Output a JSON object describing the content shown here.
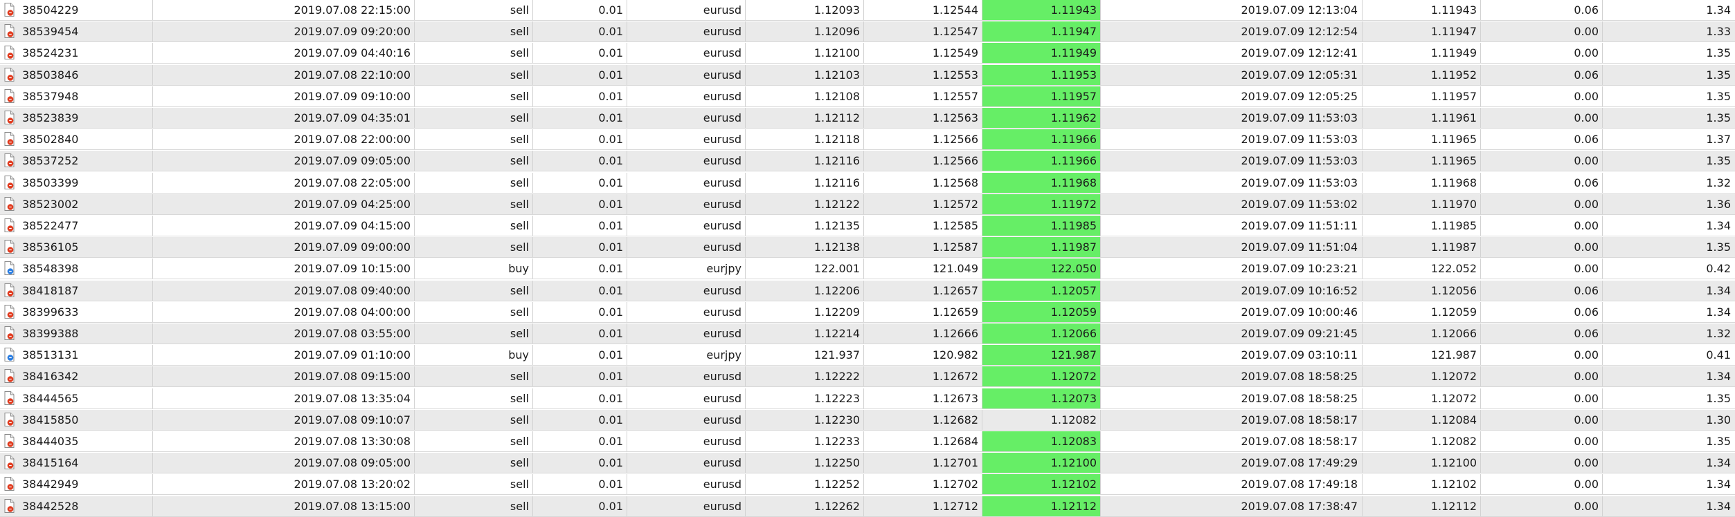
{
  "colors": {
    "highlight": "#66ee66",
    "sell_dot": "#e03a1e",
    "buy_dot": "#2a7de1",
    "row_alt": "#eaeaea"
  },
  "rows": [
    {
      "ticket": "38504229",
      "open_time": "2019.07.08 22:15:00",
      "type": "sell",
      "volume": "0.01",
      "symbol": "eurusd",
      "open_price": "1.12093",
      "sl": "1.12544",
      "tp": "1.11943",
      "tp_hit": true,
      "close_time": "2019.07.09 12:13:04",
      "close_price": "1.11943",
      "commission": "0.06",
      "swap": "1.34",
      "icon": "sell-order-icon"
    },
    {
      "ticket": "38539454",
      "open_time": "2019.07.09 09:20:00",
      "type": "sell",
      "volume": "0.01",
      "symbol": "eurusd",
      "open_price": "1.12096",
      "sl": "1.12547",
      "tp": "1.11947",
      "tp_hit": true,
      "close_time": "2019.07.09 12:12:54",
      "close_price": "1.11947",
      "commission": "0.00",
      "swap": "1.33",
      "icon": "sell-order-icon"
    },
    {
      "ticket": "38524231",
      "open_time": "2019.07.09 04:40:16",
      "type": "sell",
      "volume": "0.01",
      "symbol": "eurusd",
      "open_price": "1.12100",
      "sl": "1.12549",
      "tp": "1.11949",
      "tp_hit": true,
      "close_time": "2019.07.09 12:12:41",
      "close_price": "1.11949",
      "commission": "0.00",
      "swap": "1.35",
      "icon": "sell-order-icon"
    },
    {
      "ticket": "38503846",
      "open_time": "2019.07.08 22:10:00",
      "type": "sell",
      "volume": "0.01",
      "symbol": "eurusd",
      "open_price": "1.12103",
      "sl": "1.12553",
      "tp": "1.11953",
      "tp_hit": true,
      "close_time": "2019.07.09 12:05:31",
      "close_price": "1.11952",
      "commission": "0.06",
      "swap": "1.35",
      "icon": "sell-order-icon"
    },
    {
      "ticket": "38537948",
      "open_time": "2019.07.09 09:10:00",
      "type": "sell",
      "volume": "0.01",
      "symbol": "eurusd",
      "open_price": "1.12108",
      "sl": "1.12557",
      "tp": "1.11957",
      "tp_hit": true,
      "close_time": "2019.07.09 12:05:25",
      "close_price": "1.11957",
      "commission": "0.00",
      "swap": "1.35",
      "icon": "sell-order-icon"
    },
    {
      "ticket": "38523839",
      "open_time": "2019.07.09 04:35:01",
      "type": "sell",
      "volume": "0.01",
      "symbol": "eurusd",
      "open_price": "1.12112",
      "sl": "1.12563",
      "tp": "1.11962",
      "tp_hit": true,
      "close_time": "2019.07.09 11:53:03",
      "close_price": "1.11961",
      "commission": "0.00",
      "swap": "1.35",
      "icon": "sell-order-icon"
    },
    {
      "ticket": "38502840",
      "open_time": "2019.07.08 22:00:00",
      "type": "sell",
      "volume": "0.01",
      "symbol": "eurusd",
      "open_price": "1.12118",
      "sl": "1.12566",
      "tp": "1.11966",
      "tp_hit": true,
      "close_time": "2019.07.09 11:53:03",
      "close_price": "1.11965",
      "commission": "0.06",
      "swap": "1.37",
      "icon": "sell-order-icon"
    },
    {
      "ticket": "38537252",
      "open_time": "2019.07.09 09:05:00",
      "type": "sell",
      "volume": "0.01",
      "symbol": "eurusd",
      "open_price": "1.12116",
      "sl": "1.12566",
      "tp": "1.11966",
      "tp_hit": true,
      "close_time": "2019.07.09 11:53:03",
      "close_price": "1.11965",
      "commission": "0.00",
      "swap": "1.35",
      "icon": "sell-order-icon"
    },
    {
      "ticket": "38503399",
      "open_time": "2019.07.08 22:05:00",
      "type": "sell",
      "volume": "0.01",
      "symbol": "eurusd",
      "open_price": "1.12116",
      "sl": "1.12568",
      "tp": "1.11968",
      "tp_hit": true,
      "close_time": "2019.07.09 11:53:03",
      "close_price": "1.11968",
      "commission": "0.06",
      "swap": "1.32",
      "icon": "sell-order-icon"
    },
    {
      "ticket": "38523002",
      "open_time": "2019.07.09 04:25:00",
      "type": "sell",
      "volume": "0.01",
      "symbol": "eurusd",
      "open_price": "1.12122",
      "sl": "1.12572",
      "tp": "1.11972",
      "tp_hit": true,
      "close_time": "2019.07.09 11:53:02",
      "close_price": "1.11970",
      "commission": "0.00",
      "swap": "1.36",
      "icon": "sell-order-icon"
    },
    {
      "ticket": "38522477",
      "open_time": "2019.07.09 04:15:00",
      "type": "sell",
      "volume": "0.01",
      "symbol": "eurusd",
      "open_price": "1.12135",
      "sl": "1.12585",
      "tp": "1.11985",
      "tp_hit": true,
      "close_time": "2019.07.09 11:51:11",
      "close_price": "1.11985",
      "commission": "0.00",
      "swap": "1.34",
      "icon": "sell-order-icon"
    },
    {
      "ticket": "38536105",
      "open_time": "2019.07.09 09:00:00",
      "type": "sell",
      "volume": "0.01",
      "symbol": "eurusd",
      "open_price": "1.12138",
      "sl": "1.12587",
      "tp": "1.11987",
      "tp_hit": true,
      "close_time": "2019.07.09 11:51:04",
      "close_price": "1.11987",
      "commission": "0.00",
      "swap": "1.35",
      "icon": "sell-order-icon"
    },
    {
      "ticket": "38548398",
      "open_time": "2019.07.09 10:15:00",
      "type": "buy",
      "volume": "0.01",
      "symbol": "eurjpy",
      "open_price": "122.001",
      "sl": "121.049",
      "tp": "122.050",
      "tp_hit": true,
      "close_time": "2019.07.09 10:23:21",
      "close_price": "122.052",
      "commission": "0.00",
      "swap": "0.42",
      "icon": "buy-order-icon"
    },
    {
      "ticket": "38418187",
      "open_time": "2019.07.08 09:40:00",
      "type": "sell",
      "volume": "0.01",
      "symbol": "eurusd",
      "open_price": "1.12206",
      "sl": "1.12657",
      "tp": "1.12057",
      "tp_hit": true,
      "close_time": "2019.07.09 10:16:52",
      "close_price": "1.12056",
      "commission": "0.06",
      "swap": "1.34",
      "icon": "sell-order-icon"
    },
    {
      "ticket": "38399633",
      "open_time": "2019.07.08 04:00:00",
      "type": "sell",
      "volume": "0.01",
      "symbol": "eurusd",
      "open_price": "1.12209",
      "sl": "1.12659",
      "tp": "1.12059",
      "tp_hit": true,
      "close_time": "2019.07.09 10:00:46",
      "close_price": "1.12059",
      "commission": "0.06",
      "swap": "1.34",
      "icon": "sell-order-icon"
    },
    {
      "ticket": "38399388",
      "open_time": "2019.07.08 03:55:00",
      "type": "sell",
      "volume": "0.01",
      "symbol": "eurusd",
      "open_price": "1.12214",
      "sl": "1.12666",
      "tp": "1.12066",
      "tp_hit": true,
      "close_time": "2019.07.09 09:21:45",
      "close_price": "1.12066",
      "commission": "0.06",
      "swap": "1.32",
      "icon": "sell-order-icon"
    },
    {
      "ticket": "38513131",
      "open_time": "2019.07.09 01:10:00",
      "type": "buy",
      "volume": "0.01",
      "symbol": "eurjpy",
      "open_price": "121.937",
      "sl": "120.982",
      "tp": "121.987",
      "tp_hit": true,
      "close_time": "2019.07.09 03:10:11",
      "close_price": "121.987",
      "commission": "0.00",
      "swap": "0.41",
      "icon": "buy-order-icon"
    },
    {
      "ticket": "38416342",
      "open_time": "2019.07.08 09:15:00",
      "type": "sell",
      "volume": "0.01",
      "symbol": "eurusd",
      "open_price": "1.12222",
      "sl": "1.12672",
      "tp": "1.12072",
      "tp_hit": true,
      "close_time": "2019.07.08 18:58:25",
      "close_price": "1.12072",
      "commission": "0.00",
      "swap": "1.34",
      "icon": "sell-order-icon"
    },
    {
      "ticket": "38444565",
      "open_time": "2019.07.08 13:35:04",
      "type": "sell",
      "volume": "0.01",
      "symbol": "eurusd",
      "open_price": "1.12223",
      "sl": "1.12673",
      "tp": "1.12073",
      "tp_hit": true,
      "close_time": "2019.07.08 18:58:25",
      "close_price": "1.12072",
      "commission": "0.00",
      "swap": "1.35",
      "icon": "sell-order-icon"
    },
    {
      "ticket": "38415850",
      "open_time": "2019.07.08 09:10:07",
      "type": "sell",
      "volume": "0.01",
      "symbol": "eurusd",
      "open_price": "1.12230",
      "sl": "1.12682",
      "tp": "1.12082",
      "tp_hit": false,
      "close_time": "2019.07.08 18:58:17",
      "close_price": "1.12084",
      "commission": "0.00",
      "swap": "1.30",
      "icon": "sell-order-icon"
    },
    {
      "ticket": "38444035",
      "open_time": "2019.07.08 13:30:08",
      "type": "sell",
      "volume": "0.01",
      "symbol": "eurusd",
      "open_price": "1.12233",
      "sl": "1.12684",
      "tp": "1.12083",
      "tp_hit": true,
      "close_time": "2019.07.08 18:58:17",
      "close_price": "1.12082",
      "commission": "0.00",
      "swap": "1.35",
      "icon": "sell-order-icon"
    },
    {
      "ticket": "38415164",
      "open_time": "2019.07.08 09:05:00",
      "type": "sell",
      "volume": "0.01",
      "symbol": "eurusd",
      "open_price": "1.12250",
      "sl": "1.12701",
      "tp": "1.12100",
      "tp_hit": true,
      "close_time": "2019.07.08 17:49:29",
      "close_price": "1.12100",
      "commission": "0.00",
      "swap": "1.34",
      "icon": "sell-order-icon"
    },
    {
      "ticket": "38442949",
      "open_time": "2019.07.08 13:20:02",
      "type": "sell",
      "volume": "0.01",
      "symbol": "eurusd",
      "open_price": "1.12252",
      "sl": "1.12702",
      "tp": "1.12102",
      "tp_hit": true,
      "close_time": "2019.07.08 17:49:18",
      "close_price": "1.12102",
      "commission": "0.00",
      "swap": "1.34",
      "icon": "sell-order-icon"
    },
    {
      "ticket": "38442528",
      "open_time": "2019.07.08 13:15:00",
      "type": "sell",
      "volume": "0.01",
      "symbol": "eurusd",
      "open_price": "1.12262",
      "sl": "1.12712",
      "tp": "1.12112",
      "tp_hit": true,
      "close_time": "2019.07.08 17:38:47",
      "close_price": "1.12112",
      "commission": "0.00",
      "swap": "1.34",
      "icon": "sell-order-icon"
    }
  ]
}
